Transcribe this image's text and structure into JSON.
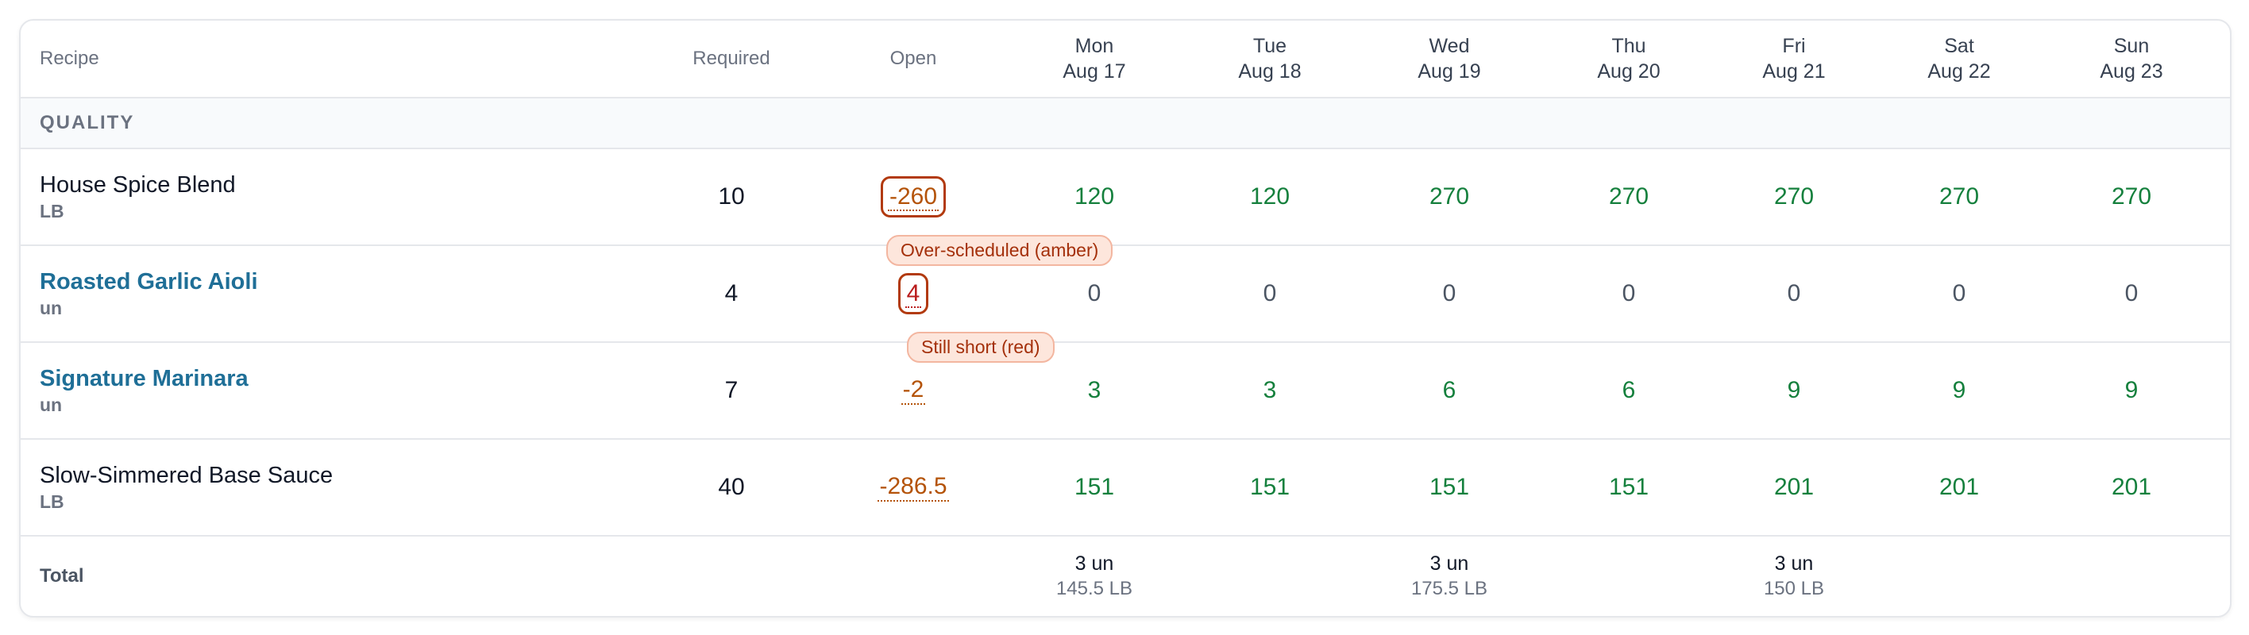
{
  "table": {
    "header": {
      "recipe": "Recipe",
      "required": "Required",
      "open": "Open",
      "days": [
        {
          "name": "Mon",
          "date": "Aug 17"
        },
        {
          "name": "Tue",
          "date": "Aug 18"
        },
        {
          "name": "Wed",
          "date": "Aug 19"
        },
        {
          "name": "Thu",
          "date": "Aug 20"
        },
        {
          "name": "Fri",
          "date": "Aug 21"
        },
        {
          "name": "Sat",
          "date": "Aug 22"
        },
        {
          "name": "Sun",
          "date": "Aug 23"
        }
      ]
    },
    "section": "QUALITY",
    "rows": [
      {
        "name": "House Spice Blend",
        "unit": "LB",
        "required": "10",
        "open": "-260",
        "days": [
          "120",
          "120",
          "270",
          "270",
          "270",
          "270",
          "270"
        ]
      },
      {
        "name": "Roasted Garlic Aioli",
        "unit": "un",
        "required": "4",
        "open": "4",
        "days": [
          "0",
          "0",
          "0",
          "0",
          "0",
          "0",
          "0"
        ]
      },
      {
        "name": "Signature Marinara",
        "unit": "un",
        "required": "7",
        "open": "-2",
        "days": [
          "3",
          "3",
          "6",
          "6",
          "9",
          "9",
          "9"
        ]
      },
      {
        "name": "Slow-Simmered Base Sauce",
        "unit": "LB",
        "required": "40",
        "open": "-286.5",
        "days": [
          "151",
          "151",
          "151",
          "151",
          "201",
          "201",
          "201"
        ]
      }
    ],
    "tooltips": {
      "amber": "Over-scheduled (amber)",
      "red": "Still short (red)"
    },
    "total": {
      "label": "Total",
      "days": [
        {
          "line1": "3 un",
          "line2": "145.5 LB"
        },
        {
          "line1": "",
          "line2": ""
        },
        {
          "line1": "3 un",
          "line2": "175.5 LB"
        },
        {
          "line1": "",
          "line2": ""
        },
        {
          "line1": "3 un",
          "line2": "150 LB"
        },
        {
          "line1": "",
          "line2": ""
        },
        {
          "line1": "",
          "line2": ""
        }
      ]
    }
  },
  "colors": {
    "green": "#15803d",
    "amber": "#b45309",
    "red": "#b91c1c",
    "link": "#1f6f97"
  }
}
